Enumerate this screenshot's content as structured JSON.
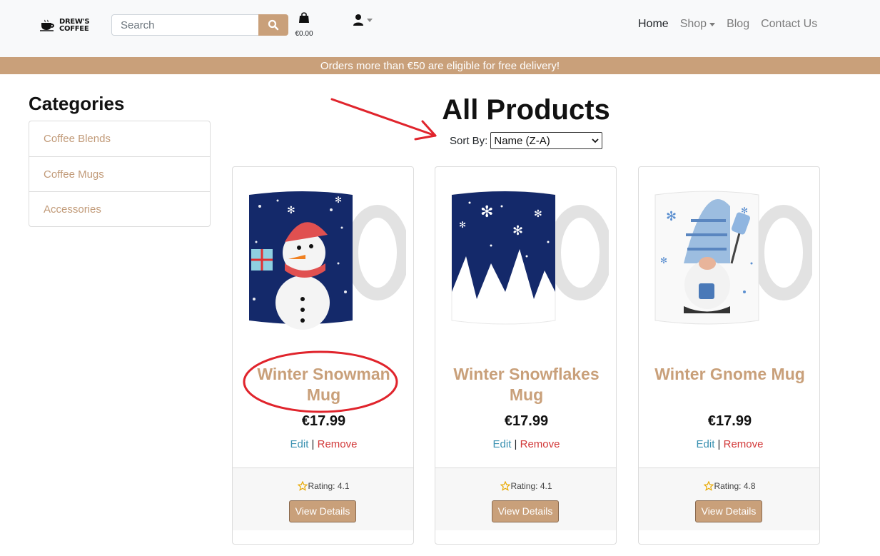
{
  "header": {
    "logo_line1": "DREW'S",
    "logo_line2": "COFFEE",
    "search_placeholder": "Search",
    "cart_total": "€0.00",
    "nav": [
      {
        "label": "Home",
        "active": true
      },
      {
        "label": "Shop",
        "dropdown": true
      },
      {
        "label": "Blog"
      },
      {
        "label": "Contact Us"
      }
    ]
  },
  "banner": {
    "text": "Orders more than €50 are eligible for free delivery!"
  },
  "sidebar": {
    "title": "Categories",
    "items": [
      {
        "label": "Coffee Blends"
      },
      {
        "label": "Coffee Mugs"
      },
      {
        "label": "Accessories"
      }
    ]
  },
  "main": {
    "title": "All Products",
    "sort_label": "Sort By:",
    "sort_value": "Name (Z-A)"
  },
  "products": [
    {
      "name": "Winter Snowman Mug",
      "price": "€17.99",
      "edit": "Edit",
      "separator": "|",
      "remove": "Remove",
      "rating": "Rating: 4.1",
      "button": "View Details"
    },
    {
      "name": "Winter Snowflakes Mug",
      "price": "€17.99",
      "edit": "Edit",
      "separator": "|",
      "remove": "Remove",
      "rating": "Rating: 4.1",
      "button": "View Details"
    },
    {
      "name": "Winter Gnome Mug",
      "price": "€17.99",
      "edit": "Edit",
      "separator": "|",
      "remove": "Remove",
      "rating": "Rating: 4.8",
      "button": "View Details"
    }
  ],
  "colors": {
    "brand": "#c9a07a",
    "annotation_red": "#e0242c",
    "mug_navy": "#14296a"
  }
}
